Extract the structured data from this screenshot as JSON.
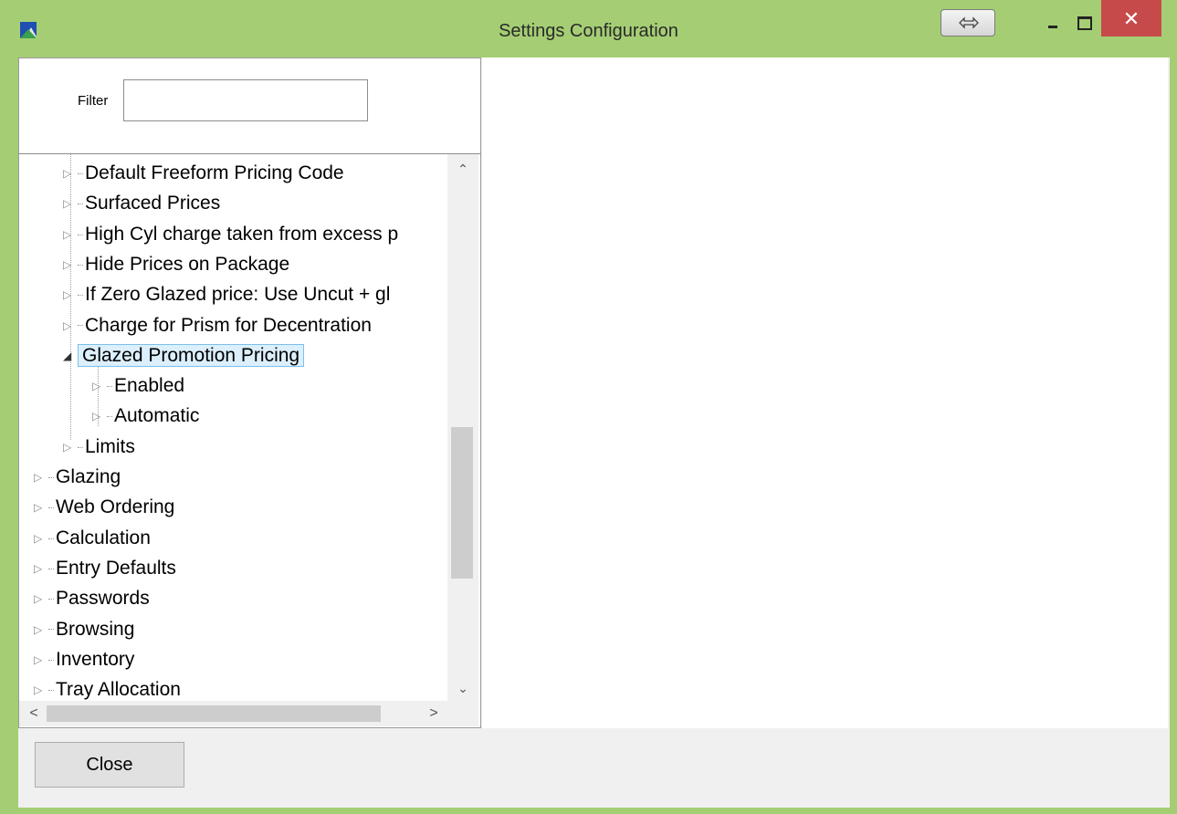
{
  "window": {
    "title": "Settings Configuration",
    "close_glyph": "✕"
  },
  "filter": {
    "label": "Filter",
    "value": ""
  },
  "tree": {
    "items": [
      {
        "label": "Default Freeform Pricing Code",
        "level": 1,
        "expanded": false,
        "selected": false
      },
      {
        "label": "Surfaced Prices",
        "level": 1,
        "expanded": false,
        "selected": false
      },
      {
        "label": "High Cyl charge taken from excess p",
        "level": 1,
        "expanded": false,
        "selected": false
      },
      {
        "label": "Hide Prices on Package",
        "level": 1,
        "expanded": false,
        "selected": false
      },
      {
        "label": "If Zero Glazed price: Use Uncut + gl",
        "level": 1,
        "expanded": false,
        "selected": false
      },
      {
        "label": "Charge for Prism for Decentration",
        "level": 1,
        "expanded": false,
        "selected": false
      },
      {
        "label": "Glazed Promotion Pricing",
        "level": 1,
        "expanded": true,
        "selected": true
      },
      {
        "label": "Enabled",
        "level": 2,
        "expanded": false,
        "selected": false
      },
      {
        "label": "Automatic",
        "level": 2,
        "expanded": false,
        "selected": false
      },
      {
        "label": "Limits",
        "level": 1,
        "expanded": false,
        "selected": false
      },
      {
        "label": "Glazing",
        "level": 0,
        "expanded": false,
        "selected": false
      },
      {
        "label": "Web Ordering",
        "level": 0,
        "expanded": false,
        "selected": false
      },
      {
        "label": "Calculation",
        "level": 0,
        "expanded": false,
        "selected": false
      },
      {
        "label": "Entry Defaults",
        "level": 0,
        "expanded": false,
        "selected": false
      },
      {
        "label": "Passwords",
        "level": 0,
        "expanded": false,
        "selected": false
      },
      {
        "label": "Browsing",
        "level": 0,
        "expanded": false,
        "selected": false
      },
      {
        "label": "Inventory",
        "level": 0,
        "expanded": false,
        "selected": false
      },
      {
        "label": "Tray Allocation",
        "level": 0,
        "expanded": false,
        "selected": false
      }
    ]
  },
  "footer": {
    "close_label": "Close"
  },
  "colors": {
    "frame": "#a5ce74",
    "close_button_bg": "#c74a4a",
    "selection_bg": "#dceffc",
    "selection_border": "#7cc0ea"
  }
}
